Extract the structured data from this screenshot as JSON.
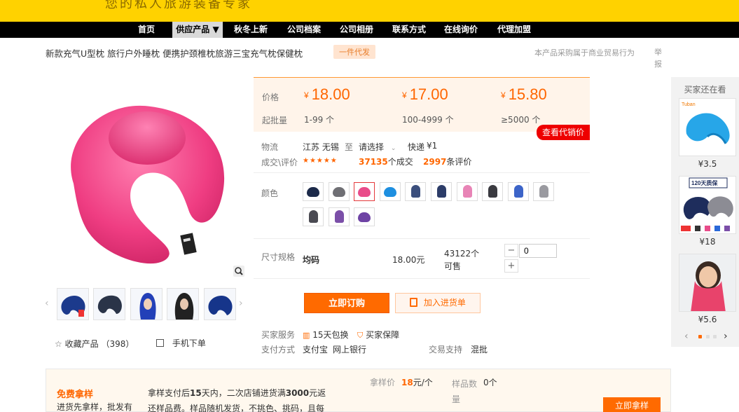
{
  "banner": {
    "slogan": "您的私人旅游装备专家"
  },
  "nav": {
    "items": [
      {
        "label": "首页"
      },
      {
        "label": "供应产品 ▼"
      },
      {
        "label": "秋冬上新"
      },
      {
        "label": "公司档案"
      },
      {
        "label": "公司相册"
      },
      {
        "label": "联系方式"
      },
      {
        "label": "在线询价"
      },
      {
        "label": "代理加盟"
      }
    ]
  },
  "product": {
    "title": "新款充气U型枕 旅行户外睡枕 便携护颈椎枕旅游三宝充气枕保健枕",
    "badge": "一件代发",
    "note": "本产品采购属于商业贸易行为",
    "report": "举报",
    "fav_label": "收藏产品",
    "fav_count": "（398）",
    "mobile_label": "手机下单"
  },
  "pricing": {
    "price_label": "价格",
    "moq_label": "起批量",
    "tiers": [
      {
        "price": "18.00",
        "qty": "1-99 个"
      },
      {
        "price": "17.00",
        "qty": "100-4999 个"
      },
      {
        "price": "15.80",
        "qty": "≥5000 个"
      }
    ],
    "currency": "¥",
    "agent_button": "查看代销价"
  },
  "logistics": {
    "label": "物流",
    "from": "江苏 无锡",
    "to_word": "至",
    "to_select": "请选择",
    "express": "快递",
    "fee": "¥1"
  },
  "deals": {
    "label": "成交\\评价",
    "stars": "★★★★★",
    "sold_count": "37135",
    "sold_suffix": "个成交",
    "review_count": "2997",
    "review_suffix": "条评价"
  },
  "colors": {
    "label": "颜色",
    "swatches": [
      {
        "name": "navy-pillow",
        "color": "#1c2a4a"
      },
      {
        "name": "grey-pillow",
        "color": "#6f6f74"
      },
      {
        "name": "rose-pillow",
        "color": "#e94c8a"
      },
      {
        "name": "sky-pillow",
        "color": "#1e8fe0"
      },
      {
        "name": "navy-hood",
        "color": "#3b4f7d"
      },
      {
        "name": "dark-blue-hood",
        "color": "#2c3c68"
      },
      {
        "name": "pink-hood",
        "color": "#e884b6"
      },
      {
        "name": "black-hood",
        "color": "#3a3a40"
      },
      {
        "name": "royal-blue-hood",
        "color": "#3c64c8"
      },
      {
        "name": "light-grey-hood",
        "color": "#9a9aa0"
      },
      {
        "name": "charcoal-hood",
        "color": "#4a4a52"
      },
      {
        "name": "purple-hood",
        "color": "#7b4fa8"
      },
      {
        "name": "purple-pillow",
        "color": "#6e43a4"
      }
    ]
  },
  "size": {
    "label": "尺寸规格",
    "value": "均码",
    "price": "18.00元",
    "stock": "43122个可售",
    "minus": "−",
    "plus": "+",
    "quantity": "0"
  },
  "actions": {
    "order_now": "立即订购",
    "add_cart": "加入进货单"
  },
  "services": {
    "label": "买家服务",
    "items": [
      "15天包换",
      "买家保障"
    ],
    "pay_label": "支付方式",
    "pay_methods": [
      "支付宝",
      "网上银行"
    ],
    "trade_label": "交易支持",
    "trade_value": "混批"
  },
  "recommend": {
    "title": "买家还在看",
    "items": [
      {
        "price": "¥3.5",
        "brand": "Tuban",
        "accent": "#27a6e8"
      },
      {
        "price": "¥18",
        "brand": "120天质保",
        "accent": "#1e2d5c"
      },
      {
        "price": "¥5.6",
        "brand": "",
        "accent": "#e8436b"
      }
    ],
    "prev": "‹",
    "next": "›"
  },
  "sample": {
    "title": "免费拿样",
    "subtitle": "进货先拿样，批发有",
    "desc_prefix": "拿样支付后",
    "desc_days": "15",
    "desc_mid": "天内，二次店铺进货满",
    "desc_amount": "3000",
    "desc_suffix": "元返",
    "desc_line2": "还样品费。样品随机发货，不挑色、挑码，且每",
    "price_label": "拿样价",
    "price_value": "18",
    "price_unit": "元/个",
    "count_label": "样品数",
    "count_label2": "量",
    "count_value": "0个",
    "button": "立即拿样"
  },
  "thumbs": {
    "prev": "‹",
    "next": "›",
    "items": [
      {
        "name": "thumb-navy-pillow",
        "color": "#1c3a8c"
      },
      {
        "name": "thumb-grey-pillow",
        "color": "#2a3448"
      },
      {
        "name": "thumb-blue-hood",
        "color": "#2340b8"
      },
      {
        "name": "thumb-black-hood",
        "color": "#222"
      },
      {
        "name": "thumb-navy-pillow-2",
        "color": "#16358a"
      }
    ]
  }
}
